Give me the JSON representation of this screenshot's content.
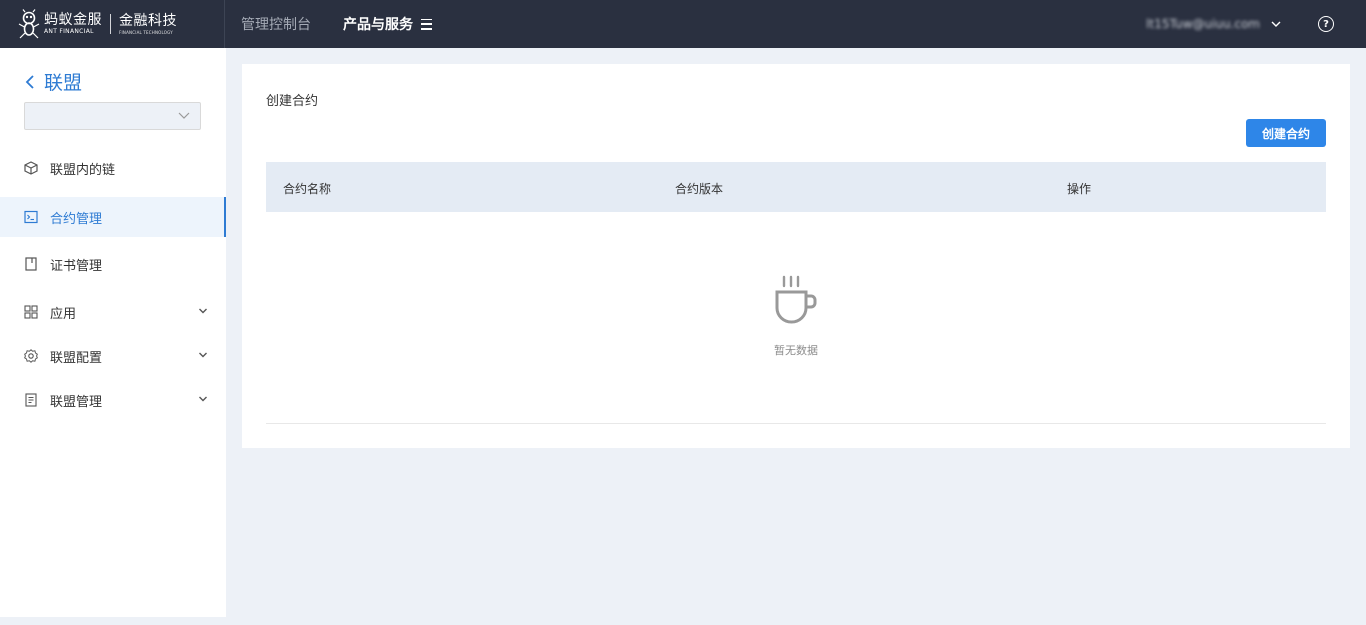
{
  "header": {
    "logo": {
      "ant_cn": "蚂蚁金服",
      "ant_en": "ANT FINANCIAL",
      "fintech_cn": "金融科技",
      "fintech_en": "FINANCIAL TECHNOLOGY"
    },
    "nav_console": "管理控制台",
    "nav_products": "产品与服务",
    "user_email": "lt15Tuw@uiuu.com",
    "icons": {
      "menu": "menu-icon",
      "user_chevron": "chevron-down-icon",
      "help": "help-icon"
    }
  },
  "sidebar": {
    "back_label": "联盟",
    "select_value": "",
    "items": [
      {
        "label": "联盟内的链",
        "icon": "cube-icon",
        "active": false,
        "expandable": false
      },
      {
        "label": "合约管理",
        "icon": "terminal-icon",
        "active": true,
        "expandable": false
      },
      {
        "label": "证书管理",
        "icon": "document-icon",
        "active": false,
        "expandable": false
      },
      {
        "label": "应用",
        "icon": "grid-icon",
        "active": false,
        "expandable": true
      },
      {
        "label": "联盟配置",
        "icon": "gear-icon",
        "active": false,
        "expandable": true
      },
      {
        "label": "联盟管理",
        "icon": "list-icon",
        "active": false,
        "expandable": true
      }
    ]
  },
  "main": {
    "title": "创建合约",
    "create_button": "创建合约",
    "table": {
      "columns": [
        "合约名称",
        "合约版本",
        "操作"
      ],
      "rows": []
    },
    "empty_text": "暂无数据"
  },
  "colors": {
    "topbar": "#2a3040",
    "accent": "#2e7bd3",
    "button": "#2e86e8",
    "table_header": "#e4ebf4",
    "page_bg": "#edf1f7"
  }
}
